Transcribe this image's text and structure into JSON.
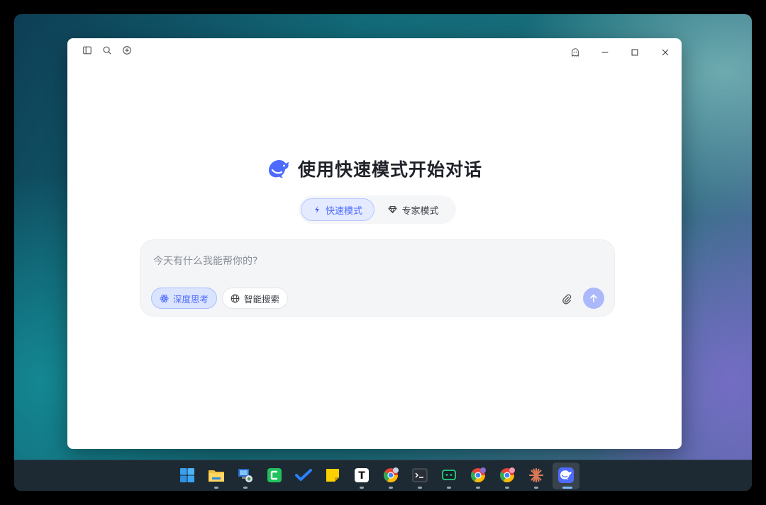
{
  "window": {
    "toolbar_icons": [
      "sidebar-icon",
      "search-icon",
      "new-chat-icon"
    ],
    "controls": [
      "ghost-icon",
      "minimize-icon",
      "maximize-icon",
      "close-icon"
    ]
  },
  "hero": {
    "title": "使用快速模式开始对话",
    "logo": "deepseek-whale-logo",
    "brand_color": "#4d6bfe"
  },
  "modes": {
    "fast_label": "快速模式",
    "expert_label": "专家模式",
    "selected": "快速模式"
  },
  "composer": {
    "placeholder": "今天有什么我能帮你的?",
    "value": "",
    "deep_think_label": "深度思考",
    "smart_search_label": "智能搜索",
    "deep_think_enabled": true,
    "smart_search_enabled": false
  },
  "taskbar": {
    "apps": [
      "windows-start",
      "file-explorer",
      "remote-desktop",
      "green-app",
      "todo",
      "sticky-notes",
      "typora",
      "chrome",
      "terminal",
      "chat-app",
      "chrome-profile-2",
      "chrome-profile-3",
      "claude",
      "deepseek"
    ],
    "active": "deepseek"
  }
}
